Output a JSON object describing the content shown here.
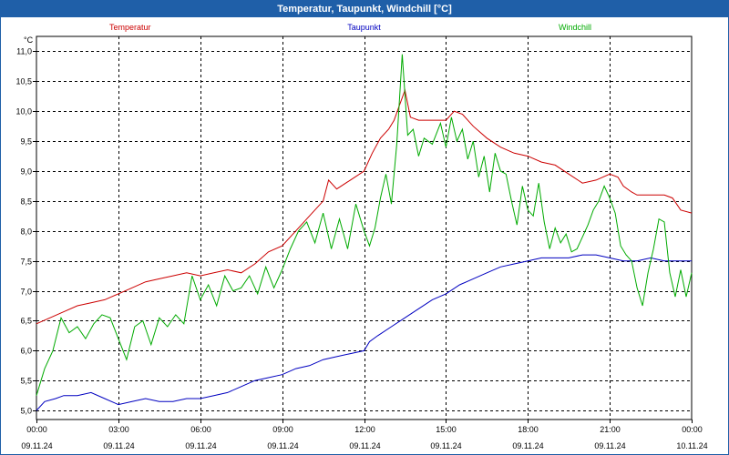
{
  "window": {
    "title": "Temperatur, Taupunkt, Windchill [°C]"
  },
  "colors": {
    "titlebar": "#1f5fa8",
    "grid": "#000000"
  },
  "chart_data": {
    "type": "line",
    "ylabel": "°C",
    "ylim": [
      4.85,
      11.25
    ],
    "xlim": [
      0,
      24
    ],
    "grid": true,
    "legend_position": "top",
    "yticks": [
      {
        "v": 5.0,
        "label": "5,0"
      },
      {
        "v": 5.5,
        "label": "5,5"
      },
      {
        "v": 6.0,
        "label": "6,0"
      },
      {
        "v": 6.5,
        "label": "6,5"
      },
      {
        "v": 7.0,
        "label": "7,0"
      },
      {
        "v": 7.5,
        "label": "7,5"
      },
      {
        "v": 8.0,
        "label": "8,0"
      },
      {
        "v": 8.5,
        "label": "8,5"
      },
      {
        "v": 9.0,
        "label": "9,0"
      },
      {
        "v": 9.5,
        "label": "9,5"
      },
      {
        "v": 10.0,
        "label": "10,0"
      },
      {
        "v": 10.5,
        "label": "10,5"
      },
      {
        "v": 11.0,
        "label": "11,0"
      }
    ],
    "xticks": [
      {
        "h": 0,
        "time": "00:00",
        "date": "09.11.24"
      },
      {
        "h": 3,
        "time": "03:00",
        "date": "09.11.24"
      },
      {
        "h": 6,
        "time": "06:00",
        "date": "09.11.24"
      },
      {
        "h": 9,
        "time": "09:00",
        "date": "09.11.24"
      },
      {
        "h": 12,
        "time": "12:00",
        "date": "09.11.24"
      },
      {
        "h": 15,
        "time": "15:00",
        "date": "09.11.24"
      },
      {
        "h": 18,
        "time": "18:00",
        "date": "09.11.24"
      },
      {
        "h": 21,
        "time": "21:00",
        "date": "09.11.24"
      },
      {
        "h": 24,
        "time": "00:00",
        "date": "10.11.24"
      }
    ],
    "series": [
      {
        "name": "Temperatur",
        "color": "#cc0000",
        "legend_align": "start",
        "points": [
          [
            0,
            6.45
          ],
          [
            0.5,
            6.55
          ],
          [
            1,
            6.65
          ],
          [
            1.5,
            6.75
          ],
          [
            2,
            6.8
          ],
          [
            2.5,
            6.85
          ],
          [
            3,
            6.95
          ],
          [
            3.5,
            7.05
          ],
          [
            4,
            7.15
          ],
          [
            4.5,
            7.2
          ],
          [
            5,
            7.25
          ],
          [
            5.5,
            7.3
          ],
          [
            6,
            7.25
          ],
          [
            6.5,
            7.3
          ],
          [
            7,
            7.35
          ],
          [
            7.5,
            7.3
          ],
          [
            8,
            7.45
          ],
          [
            8.5,
            7.65
          ],
          [
            9,
            7.75
          ],
          [
            9.5,
            8.0
          ],
          [
            10,
            8.25
          ],
          [
            10.5,
            8.5
          ],
          [
            10.7,
            8.85
          ],
          [
            11,
            8.7
          ],
          [
            11.5,
            8.85
          ],
          [
            12,
            9.0
          ],
          [
            12.3,
            9.3
          ],
          [
            12.6,
            9.55
          ],
          [
            12.9,
            9.7
          ],
          [
            13.1,
            9.85
          ],
          [
            13.3,
            10.1
          ],
          [
            13.5,
            10.35
          ],
          [
            13.7,
            9.9
          ],
          [
            14,
            9.85
          ],
          [
            14.5,
            9.85
          ],
          [
            15,
            9.85
          ],
          [
            15.3,
            10.0
          ],
          [
            15.6,
            9.95
          ],
          [
            16,
            9.75
          ],
          [
            16.5,
            9.55
          ],
          [
            17,
            9.4
          ],
          [
            17.5,
            9.3
          ],
          [
            18,
            9.25
          ],
          [
            18.5,
            9.15
          ],
          [
            19,
            9.1
          ],
          [
            19.5,
            8.95
          ],
          [
            20,
            8.8
          ],
          [
            20.5,
            8.85
          ],
          [
            21,
            8.95
          ],
          [
            21.3,
            8.9
          ],
          [
            21.5,
            8.75
          ],
          [
            21.8,
            8.65
          ],
          [
            22,
            8.6
          ],
          [
            22.5,
            8.6
          ],
          [
            23,
            8.6
          ],
          [
            23.3,
            8.55
          ],
          [
            23.6,
            8.35
          ],
          [
            24,
            8.3
          ]
        ]
      },
      {
        "name": "Taupunkt",
        "color": "#0000c0",
        "legend_align": "middle",
        "points": [
          [
            0,
            5.0
          ],
          [
            0.3,
            5.15
          ],
          [
            0.7,
            5.2
          ],
          [
            1,
            5.25
          ],
          [
            1.5,
            5.25
          ],
          [
            2,
            5.3
          ],
          [
            2.5,
            5.2
          ],
          [
            3,
            5.1
          ],
          [
            3.5,
            5.15
          ],
          [
            4,
            5.2
          ],
          [
            4.5,
            5.15
          ],
          [
            5,
            5.15
          ],
          [
            5.5,
            5.2
          ],
          [
            6,
            5.2
          ],
          [
            6.5,
            5.25
          ],
          [
            7,
            5.3
          ],
          [
            7.5,
            5.4
          ],
          [
            8,
            5.5
          ],
          [
            8.5,
            5.55
          ],
          [
            9,
            5.6
          ],
          [
            9.5,
            5.7
          ],
          [
            10,
            5.75
          ],
          [
            10.5,
            5.85
          ],
          [
            11,
            5.9
          ],
          [
            11.5,
            5.95
          ],
          [
            12,
            6.0
          ],
          [
            12.2,
            6.15
          ],
          [
            12.5,
            6.25
          ],
          [
            13,
            6.4
          ],
          [
            13.5,
            6.55
          ],
          [
            14,
            6.7
          ],
          [
            14.5,
            6.85
          ],
          [
            15,
            6.95
          ],
          [
            15.5,
            7.1
          ],
          [
            16,
            7.2
          ],
          [
            16.5,
            7.3
          ],
          [
            17,
            7.4
          ],
          [
            17.5,
            7.45
          ],
          [
            18,
            7.5
          ],
          [
            18.5,
            7.55
          ],
          [
            19,
            7.55
          ],
          [
            19.5,
            7.55
          ],
          [
            20,
            7.6
          ],
          [
            20.5,
            7.6
          ],
          [
            21,
            7.55
          ],
          [
            21.5,
            7.5
          ],
          [
            22,
            7.5
          ],
          [
            22.5,
            7.55
          ],
          [
            23,
            7.5
          ],
          [
            23.5,
            7.5
          ],
          [
            24,
            7.5
          ]
        ]
      },
      {
        "name": "Windchill",
        "color": "#00aa00",
        "legend_align": "end",
        "points": [
          [
            0,
            5.25
          ],
          [
            0.3,
            5.7
          ],
          [
            0.6,
            6.0
          ],
          [
            0.9,
            6.55
          ],
          [
            1.2,
            6.3
          ],
          [
            1.5,
            6.4
          ],
          [
            1.8,
            6.2
          ],
          [
            2.1,
            6.45
          ],
          [
            2.4,
            6.6
          ],
          [
            2.7,
            6.55
          ],
          [
            3.0,
            6.2
          ],
          [
            3.3,
            5.85
          ],
          [
            3.6,
            6.4
          ],
          [
            3.9,
            6.5
          ],
          [
            4.2,
            6.1
          ],
          [
            4.5,
            6.55
          ],
          [
            4.8,
            6.4
          ],
          [
            5.1,
            6.6
          ],
          [
            5.4,
            6.45
          ],
          [
            5.7,
            7.25
          ],
          [
            6.0,
            6.85
          ],
          [
            6.3,
            7.1
          ],
          [
            6.6,
            6.75
          ],
          [
            6.9,
            7.25
          ],
          [
            7.2,
            7.0
          ],
          [
            7.5,
            7.05
          ],
          [
            7.8,
            7.25
          ],
          [
            8.1,
            6.95
          ],
          [
            8.4,
            7.4
          ],
          [
            8.7,
            7.05
          ],
          [
            9.0,
            7.35
          ],
          [
            9.3,
            7.7
          ],
          [
            9.6,
            8.0
          ],
          [
            9.9,
            8.15
          ],
          [
            10.2,
            7.8
          ],
          [
            10.5,
            8.3
          ],
          [
            10.8,
            7.7
          ],
          [
            11.1,
            8.2
          ],
          [
            11.4,
            7.7
          ],
          [
            11.7,
            8.45
          ],
          [
            12.0,
            8.0
          ],
          [
            12.2,
            7.75
          ],
          [
            12.4,
            8.05
          ],
          [
            12.6,
            8.55
          ],
          [
            12.8,
            8.95
          ],
          [
            13.0,
            8.45
          ],
          [
            13.2,
            9.45
          ],
          [
            13.4,
            10.95
          ],
          [
            13.6,
            9.6
          ],
          [
            13.8,
            9.7
          ],
          [
            14.0,
            9.25
          ],
          [
            14.2,
            9.55
          ],
          [
            14.5,
            9.45
          ],
          [
            14.8,
            9.8
          ],
          [
            15.0,
            9.4
          ],
          [
            15.2,
            9.9
          ],
          [
            15.4,
            9.5
          ],
          [
            15.6,
            9.7
          ],
          [
            15.8,
            9.2
          ],
          [
            16.0,
            9.5
          ],
          [
            16.2,
            8.9
          ],
          [
            16.4,
            9.25
          ],
          [
            16.6,
            8.65
          ],
          [
            16.8,
            9.3
          ],
          [
            17.0,
            9.0
          ],
          [
            17.2,
            8.95
          ],
          [
            17.4,
            8.5
          ],
          [
            17.6,
            8.1
          ],
          [
            17.8,
            8.75
          ],
          [
            18.0,
            8.35
          ],
          [
            18.2,
            8.25
          ],
          [
            18.4,
            8.8
          ],
          [
            18.6,
            8.15
          ],
          [
            18.8,
            7.7
          ],
          [
            19.0,
            8.05
          ],
          [
            19.2,
            7.8
          ],
          [
            19.4,
            7.95
          ],
          [
            19.6,
            7.65
          ],
          [
            19.8,
            7.7
          ],
          [
            20.0,
            7.9
          ],
          [
            20.2,
            8.1
          ],
          [
            20.4,
            8.35
          ],
          [
            20.6,
            8.5
          ],
          [
            20.8,
            8.75
          ],
          [
            21.0,
            8.55
          ],
          [
            21.2,
            8.3
          ],
          [
            21.4,
            7.75
          ],
          [
            21.6,
            7.6
          ],
          [
            21.8,
            7.5
          ],
          [
            22.0,
            7.05
          ],
          [
            22.2,
            6.75
          ],
          [
            22.4,
            7.3
          ],
          [
            22.6,
            7.7
          ],
          [
            22.8,
            8.2
          ],
          [
            23.0,
            8.15
          ],
          [
            23.2,
            7.3
          ],
          [
            23.4,
            6.9
          ],
          [
            23.6,
            7.35
          ],
          [
            23.8,
            6.9
          ],
          [
            24,
            7.3
          ]
        ]
      }
    ]
  }
}
